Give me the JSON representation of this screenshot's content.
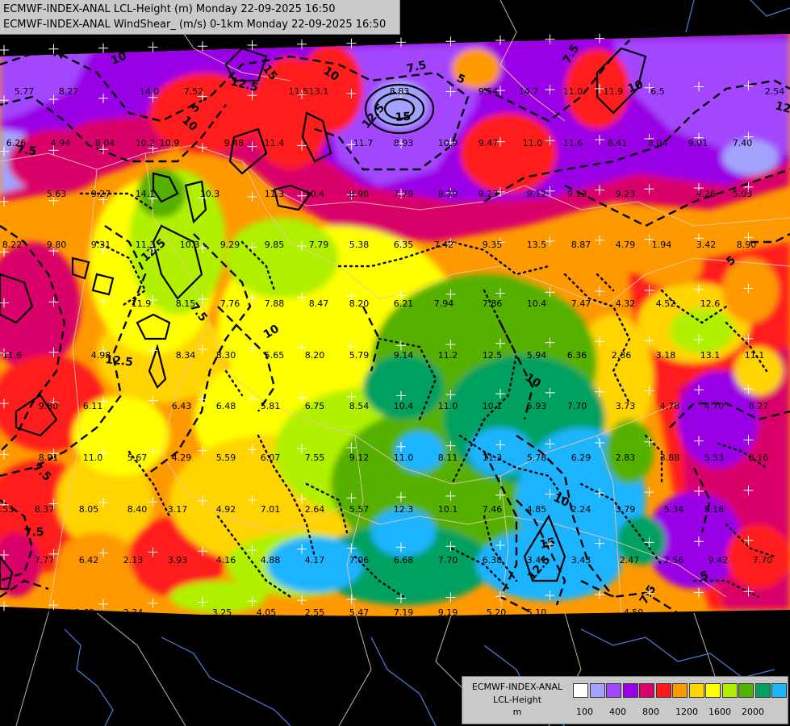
{
  "title": {
    "line1": "ECMWF-INDEX-ANAL LCL-Height (m) Monday 22-09-2025 16:50",
    "line2": "ECMWF-INDEX-ANAL WindShear_ (m/s) 0-1km Monday 22-09-2025 16:50"
  },
  "legend": {
    "line1": "ECMWF-INDEX-ANAL",
    "line2": "LCL-Height",
    "line3": "m",
    "swatches": [
      "#ffffff",
      "#a3a3ff",
      "#a347ff",
      "#9a00e6",
      "#d9006b",
      "#ff1a1a",
      "#ff9900",
      "#ffd400",
      "#ffff00",
      "#b0f000",
      "#55b000",
      "#00a060",
      "#1ab4ff"
    ],
    "tick_labels": [
      "100",
      "400",
      "800",
      "1200",
      "1600",
      "2000"
    ]
  },
  "map": {
    "colors": {
      "purple": "#a347ff",
      "violet": "#9a00e6",
      "magenta": "#d9006b",
      "red": "#ff1a1a",
      "orange": "#ff9900",
      "amber": "#ffd400",
      "yellow": "#ffff00",
      "lime": "#b0f000",
      "green": "#55b000",
      "teal": "#00a060",
      "blue": "#1ab4ff",
      "lavender": "#a3a3ff",
      "background": "#000000",
      "border": "#e0c0a0"
    },
    "values": [
      "5.77",
      "8.27",
      "14.0",
      "7.52",
      "11.5",
      "13.1",
      "8.83",
      "9.54",
      "14.7",
      "11.0",
      "11.9",
      "6.5",
      "2.54",
      "6.26",
      "4.94",
      "8.04",
      "10.2",
      "10.9",
      "9.48",
      "11.4",
      "11.7",
      "8.93",
      "10.9",
      "9.47",
      "11.0",
      "11.6",
      "8.41",
      "8.04",
      "9.01",
      "7.40",
      "5.63",
      "9.27",
      "14.1",
      "10.3",
      "11.3",
      "10.4",
      "8.98",
      "7.79",
      "8.39",
      "9.23",
      "9.12",
      "9.13",
      "9.23",
      "4.26",
      "5.03",
      "8.22",
      "9.80",
      "9.31",
      "11.3",
      "10.3",
      "9.29",
      "9.85",
      "7.79",
      "5.38",
      "6.35",
      "7.42",
      "9.35",
      "13.5",
      "8.87",
      "4.79",
      "1.94",
      "3.42",
      "8.90",
      "11.9",
      "8.15",
      "7.76",
      "7.88",
      "8.47",
      "8.20",
      "6.21",
      "7.94",
      "7.86",
      "10.4",
      "7.47",
      "4.32",
      "4.52",
      "12.6",
      "11.6",
      "4.98",
      "8.34",
      "8.30",
      "5.65",
      "8.20",
      "5.79",
      "9.14",
      "11.2",
      "12.5",
      "5.94",
      "6.36",
      "2.36",
      "3.18",
      "13.1",
      "11.1",
      "9.80",
      "6.11",
      "6.43",
      "6.48",
      "5.81",
      "6.75",
      "8.54",
      "10.4",
      "11.0",
      "10.1",
      "5.93",
      "7.70",
      "3.73",
      "4.78",
      "4.70",
      "8.27",
      "8.91",
      "11.0",
      "5.67",
      "4.29",
      "5.59",
      "6.07",
      "7.55",
      "9.12",
      "11.0",
      "8.11",
      "11.3",
      "5.78",
      "6.29",
      "2.83",
      "3.88",
      "5.53",
      "8.16",
      "8.53",
      "8.37",
      "8.05",
      "8.40",
      "3.17",
      "4.92",
      "7.01",
      "2.64",
      "5.57",
      "12.3",
      "10.1",
      "7.46",
      "4.85",
      "2.24",
      "3.79",
      "5.34",
      "8.18",
      "7.77",
      "6.42",
      "2.13",
      "3.93",
      "4.16",
      "4.88",
      "4.17",
      "7.06",
      "6.68",
      "7.70",
      "6.38",
      "3.41",
      "3.43",
      "2.47",
      "2.56",
      "9.42",
      "7.70",
      "8.97",
      "1.62",
      "2.34",
      "3.25",
      "4.05",
      "2.55",
      "5.47",
      "7.19",
      "9.19",
      "5.20",
      "5.10",
      "4.59"
    ],
    "contour_labels": [
      "7.5",
      "10",
      "12.5",
      "15",
      "5",
      "7.5",
      "10",
      "12.5",
      "15",
      "10",
      "12.5",
      "7.5",
      "5",
      "7.5",
      "10",
      "12.5",
      "7.5",
      "10",
      "12.5",
      "7.5",
      "5",
      "7.5",
      "10",
      "12.5",
      "15",
      "10",
      "7.5",
      "5"
    ]
  }
}
